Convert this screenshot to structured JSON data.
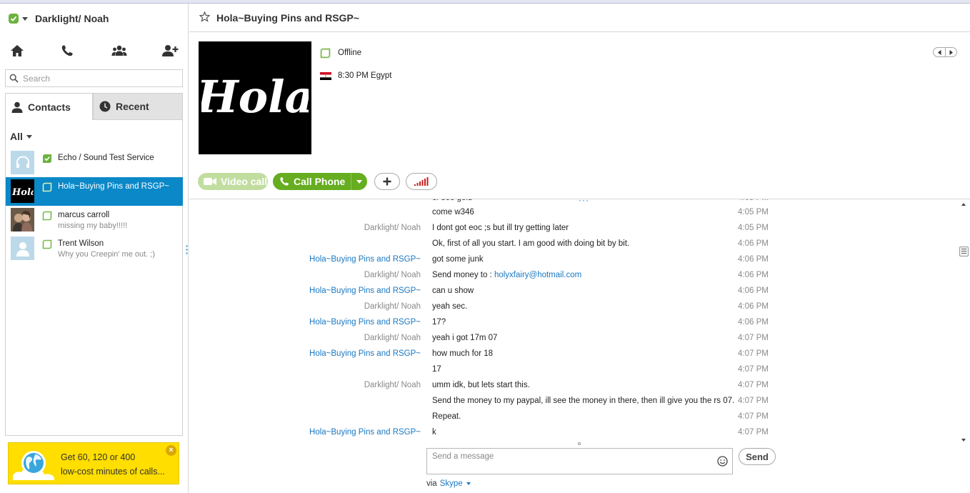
{
  "app": {
    "user_name": "Darklight/ Noah",
    "search_placeholder": "Search",
    "tabs": {
      "contacts": "Contacts",
      "recent": "Recent"
    },
    "filter_label": "All",
    "accent_color": "#0a88c8",
    "online_color": "#6db23f"
  },
  "contacts": [
    {
      "name": "Echo / Sound Test Service",
      "mood": "",
      "status": "online",
      "avatar": "headset-icon"
    },
    {
      "name": "Hola~Buying Pins and RSGP~",
      "mood": "",
      "status": "offline",
      "avatar": "hola-logo",
      "selected": true
    },
    {
      "name": "marcus carroll",
      "mood": "missing my baby!!!!!",
      "status": "offline",
      "avatar": "photo"
    },
    {
      "name": "Trent Wilson",
      "mood": "Why you Creepin' me out. ;)",
      "status": "offline",
      "avatar": "default-person-icon"
    }
  ],
  "promo": {
    "line1": "Get 60, 120 or 400",
    "line2": "low-cost minutes of calls..."
  },
  "chat": {
    "title": "Hola~Buying Pins and RSGP~",
    "status": "Offline",
    "local_time": "8:30 PM Egypt",
    "logo_text": "Hola",
    "buttons": {
      "video": "Video call",
      "call": "Call Phone"
    },
    "messages": [
      {
        "sender": "",
        "text": "come w346",
        "time": "4:05 PM",
        "from_other": false
      },
      {
        "sender": "Darklight/ Noah",
        "text": "I dont got eoc ;s but ill try getting later",
        "time": "4:05 PM",
        "from_other": false
      },
      {
        "sender": "",
        "text": "Ok, first of all you start. I am good with doing bit by bit.",
        "time": "4:06 PM",
        "from_other": false
      },
      {
        "sender": "Hola~Buying Pins and RSGP~",
        "text": "got some junk",
        "time": "4:06 PM",
        "from_other": true
      },
      {
        "sender": "Darklight/ Noah",
        "text": "Send money to : ",
        "link": "holyxfairy@hotmail.com",
        "time": "4:06 PM",
        "from_other": false
      },
      {
        "sender": "Hola~Buying Pins and RSGP~",
        "text": "can u show",
        "time": "4:06 PM",
        "from_other": true
      },
      {
        "sender": "Darklight/ Noah",
        "text": "yeah sec.",
        "time": "4:06 PM",
        "from_other": false
      },
      {
        "sender": "Hola~Buying Pins and RSGP~",
        "text": "17?",
        "time": "4:06 PM",
        "from_other": true
      },
      {
        "sender": "Darklight/ Noah",
        "text": "yeah i got 17m 07",
        "time": "4:07 PM",
        "from_other": false
      },
      {
        "sender": "Hola~Buying Pins and RSGP~",
        "text": "how much for 18",
        "time": "4:07 PM",
        "from_other": true
      },
      {
        "sender": "",
        "text": "17",
        "time": "4:07 PM",
        "from_other": true
      },
      {
        "sender": "Darklight/ Noah",
        "text": "umm idk, but lets start this.",
        "time": "4:07 PM",
        "from_other": false
      },
      {
        "sender": "",
        "text": "Send the money to my paypal, ill see the money in there, then ill give you the rs 07.",
        "time": "4:07 PM",
        "from_other": false
      },
      {
        "sender": "",
        "text": "Repeat.",
        "time": "4:07 PM",
        "from_other": false
      },
      {
        "sender": "Hola~Buying Pins and RSGP~",
        "text": "k",
        "time": "4:07 PM",
        "from_other": true
      }
    ],
    "compose_placeholder": "Send a message",
    "send_label": "Send",
    "via_label": "via",
    "via_service": "Skype"
  }
}
